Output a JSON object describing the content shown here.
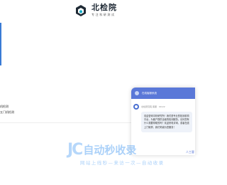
{
  "brand": {
    "name": "北检院",
    "slogan": "专注科研测试",
    "logo_icon": "cube-logo-icon",
    "accent_color": "#1ab0c8"
  },
  "sidebar": {
    "links": [
      {
        "label": "机检测"
      },
      {
        "label": "五门机检测"
      }
    ]
  },
  "chat": {
    "header_title": "在线客服系统",
    "sender": "北检研究院 客服",
    "time": "09:22",
    "message": "欢迎咨询中析研究所！我们是专业的检测机构平台，为客户提供全面的检测服务。请问您有什么需要帮助的吗？欢迎来电详询，或者在线上门取样，我们竭诚为您服务！",
    "header_color": "#5a78d8"
  },
  "watermark": {
    "mark": "JC",
    "title": "自动秒收录",
    "subtitle": "网站上线秒—来访一次—自动收录"
  },
  "side_tab": {
    "label": "人工客"
  }
}
